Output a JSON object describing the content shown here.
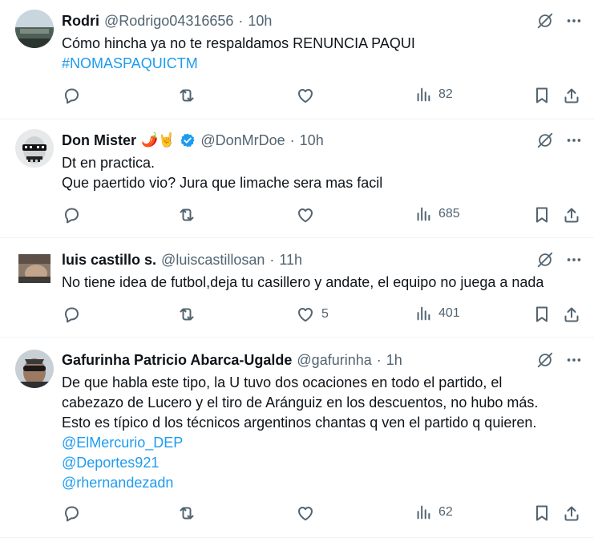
{
  "tweets": [
    {
      "name": "Rodri",
      "emoji": "",
      "verified": false,
      "handle": "@Rodrigo04316656",
      "time": "10h",
      "lines": [
        {
          "text": "Cómo hincha ya no te respaldamos RENUNCIA PAQUI",
          "link": false
        },
        {
          "text": "#NOMASPAQUICTM",
          "link": true
        }
      ],
      "likes": "",
      "views": "82"
    },
    {
      "name": "Don Mister",
      "emoji": "🌶️🤘",
      "verified": true,
      "handle": "@DonMrDoe",
      "time": "10h",
      "lines": [
        {
          "text": "Dt en practica.",
          "link": false
        },
        {
          "text": "Que paertido vio? Jura que limache sera mas facil",
          "link": false
        }
      ],
      "likes": "",
      "views": "685"
    },
    {
      "name": "luis castillo s.",
      "emoji": "",
      "verified": false,
      "handle": "@luiscastillosan",
      "time": "11h",
      "lines": [
        {
          "text": "No tiene idea de futbol,deja tu casillero y andate, el equipo no juega a nada",
          "link": false
        }
      ],
      "likes": "5",
      "views": "401"
    },
    {
      "name": "Gafurinha Patricio Abarca-Ugalde",
      "emoji": "",
      "verified": false,
      "handle": "@gafurinha",
      "time": "1h",
      "lines": [
        {
          "text": "De que habla este tipo, la U tuvo dos ocaciones en todo el partido, el",
          "link": false
        },
        {
          "text": "cabezazo de Lucero y el tiro de Aránguiz en los descuentos, no hubo más.",
          "link": false
        },
        {
          "text": "Esto es típico d los técnicos argentinos chantas q ven el partido q quieren.",
          "link": false
        },
        {
          "text": "@ElMercurio_DEP",
          "link": true
        },
        {
          "text": "@Deportes921",
          "link": true
        },
        {
          "text": "@rhernandezadn",
          "link": true
        }
      ],
      "likes": "",
      "views": "62"
    }
  ],
  "separator": "·",
  "icons": {
    "grok": "grok-icon",
    "more": "more-icon",
    "reply": "reply-icon",
    "repost": "repost-icon",
    "like": "heart-icon",
    "views": "views-icon",
    "bookmark": "bookmark-icon",
    "share": "share-icon",
    "verified": "verified-icon"
  },
  "colors": {
    "text": "#0f1419",
    "secondary": "#536471",
    "link": "#1d9bf0",
    "verified": "#1d9bf0",
    "divider": "#eff3f4"
  }
}
